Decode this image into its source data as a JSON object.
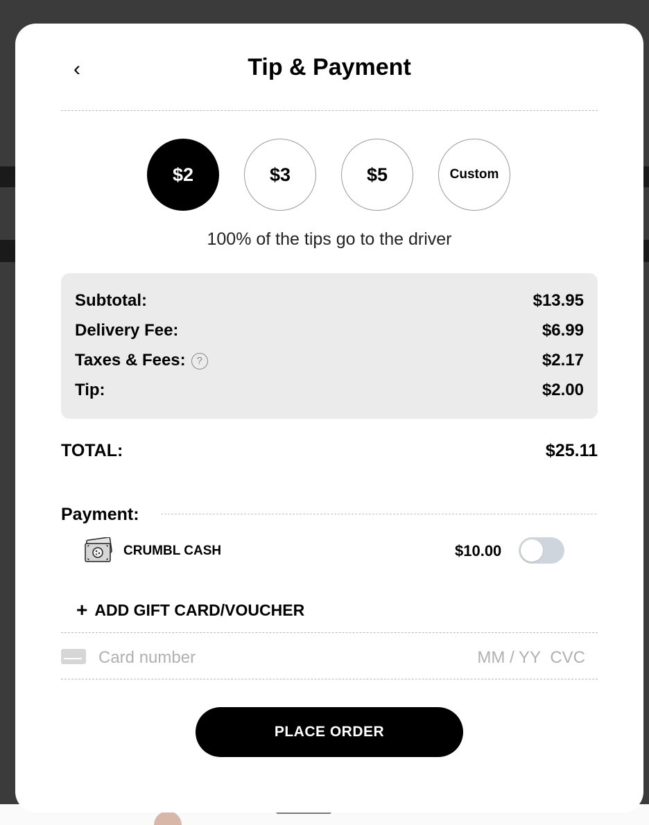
{
  "header": {
    "back_icon": "chevron-left-icon",
    "back_glyph": "‹",
    "title": "Tip & Payment"
  },
  "tips": {
    "options": [
      {
        "label": "$2",
        "selected": true
      },
      {
        "label": "$3",
        "selected": false
      },
      {
        "label": "$5",
        "selected": false
      },
      {
        "label": "Custom",
        "selected": false
      }
    ],
    "note": "100% of the tips go to the driver"
  },
  "summary": {
    "rows": [
      {
        "label": "Subtotal:",
        "value": "$13.95"
      },
      {
        "label": "Delivery Fee:",
        "value": "$6.99"
      },
      {
        "label": "Taxes & Fees:",
        "value": "$2.17",
        "help_icon": "question-circle-icon",
        "help_glyph": "?"
      },
      {
        "label": "Tip:",
        "value": "$2.00"
      }
    ]
  },
  "total": {
    "label": "TOTAL:",
    "value": "$25.11"
  },
  "payment": {
    "heading": "Payment:",
    "crumbl_cash": {
      "icon": "cash-bill-icon",
      "label": "CRUMBL CASH",
      "amount": "$10.00",
      "toggle_on": false
    },
    "add_gift": {
      "plus": "+",
      "label": "ADD GIFT CARD/VOUCHER"
    },
    "card": {
      "icon": "credit-card-icon",
      "number_placeholder": "Card number",
      "expiry_placeholder": "MM / YY",
      "cvc_placeholder": "CVC"
    }
  },
  "place_order_label": "PLACE ORDER",
  "colors": {
    "accent": "#000000",
    "summary_bg": "#ebebeb",
    "toggle_off": "#cfd5dc",
    "placeholder": "#b0b0b0"
  }
}
